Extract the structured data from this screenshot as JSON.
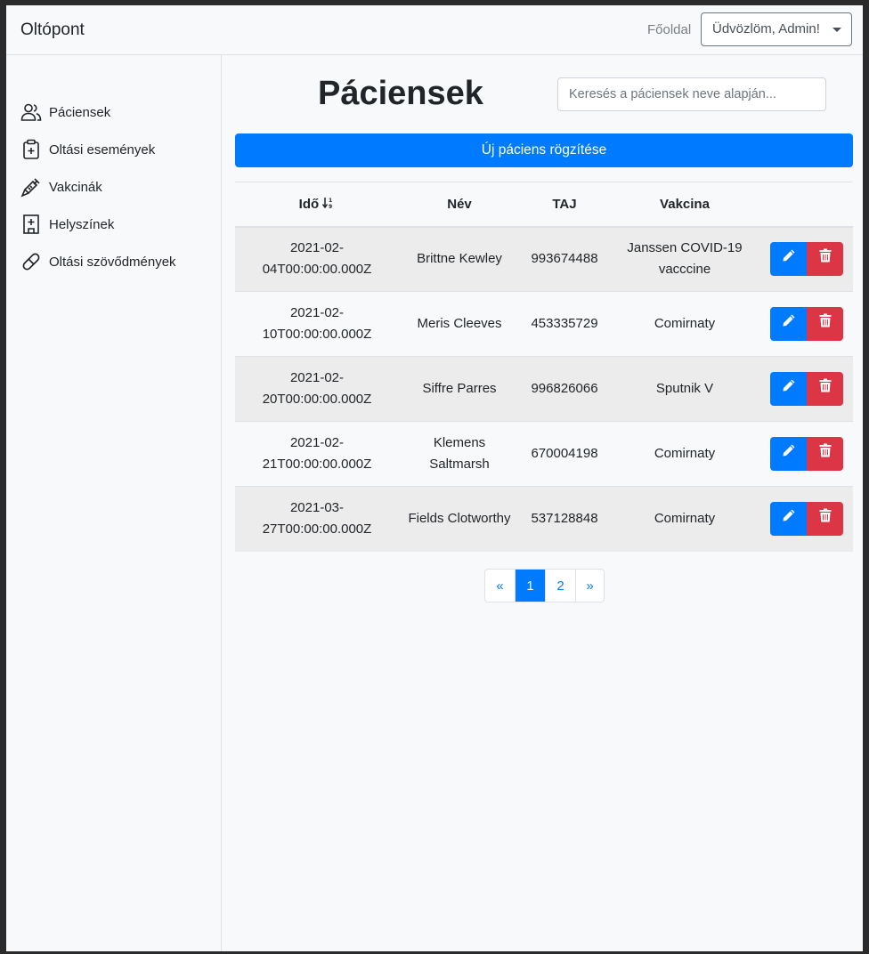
{
  "navbar": {
    "brand": "Oltópont",
    "home": "Főoldal",
    "user_menu": "Üdvözlöm, Admin!"
  },
  "sidebar": {
    "items": [
      {
        "label": "Páciensek",
        "icon": "people-icon"
      },
      {
        "label": "Oltási események",
        "icon": "clipboard-plus-icon"
      },
      {
        "label": "Vakcinák",
        "icon": "syringe-icon"
      },
      {
        "label": "Helyszínek",
        "icon": "hospital-icon"
      },
      {
        "label": "Oltási szövődmények",
        "icon": "pill-capsule-icon"
      }
    ]
  },
  "main": {
    "title": "Páciensek",
    "search_placeholder": "Keresés a páciensek neve alapján...",
    "new_button": "Új páciens rögzítése",
    "columns": {
      "time": "Idő",
      "name": "Név",
      "taj": "TAJ",
      "vaccine": "Vakcina"
    },
    "sort_icon": "sort-numeric-down-icon",
    "rows": [
      {
        "time_a": "2021-02-",
        "time_b": "04T00:00:00.000Z",
        "name": "Brittne Kewley",
        "taj": "993674488",
        "vaccine": "Janssen COVID-19 vacccine"
      },
      {
        "time_a": "2021-02-",
        "time_b": "10T00:00:00.000Z",
        "name": "Meris Cleeves",
        "taj": "453335729",
        "vaccine": "Comirnaty"
      },
      {
        "time_a": "2021-02-",
        "time_b": "20T00:00:00.000Z",
        "name": "Siffre Parres",
        "taj": "996826066",
        "vaccine": "Sputnik V"
      },
      {
        "time_a": "2021-02-",
        "time_b": "21T00:00:00.000Z",
        "name": "Klemens Saltmarsh",
        "taj": "670004198",
        "vaccine": "Comirnaty"
      },
      {
        "time_a": "2021-03-",
        "time_b": "27T00:00:00.000Z",
        "name": "Fields Clotworthy",
        "taj": "537128848",
        "vaccine": "Comirnaty"
      }
    ],
    "pagination": {
      "prev": "«",
      "pages": [
        "1",
        "2"
      ],
      "next": "»",
      "active_page": "1"
    }
  },
  "colors": {
    "primary": "#007bff",
    "danger": "#dc3545",
    "striped_row": "#ececec",
    "background": "#f8f9fa"
  }
}
